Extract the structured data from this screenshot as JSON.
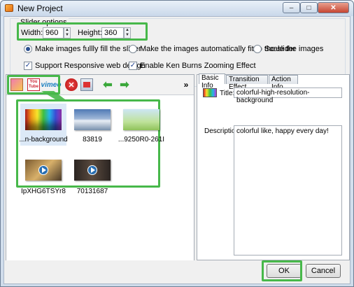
{
  "window": {
    "title": "New Project"
  },
  "slider_options": {
    "group_label": "Slider options",
    "width_label": "Width:",
    "width_value": "960",
    "height_label": "Height:",
    "height_value": "360",
    "fill_modes": [
      {
        "label": "Make images fullly fill the slider",
        "selected": true
      },
      {
        "label": "Make the images automatically fit to the slider",
        "selected": false
      },
      {
        "label": "Scale the images",
        "selected": false
      }
    ],
    "responsive": {
      "label": "Support Responsive web design",
      "checked": true
    },
    "ken_burns": {
      "label": "Enable Ken Burns Zooming Effect",
      "checked": true
    }
  },
  "toolbar": {
    "youtube_text": "You Tube",
    "vimeo_text": "vimeo",
    "expand_glyph": "»"
  },
  "thumbnails": [
    {
      "caption": "...n-background",
      "kind": "image",
      "selected": true
    },
    {
      "caption": "83819",
      "kind": "image",
      "selected": false
    },
    {
      "caption": "...9250R0-261I",
      "kind": "image",
      "selected": false
    },
    {
      "caption": "IpXHG6TSYr8",
      "kind": "video",
      "selected": false
    },
    {
      "caption": "70131687",
      "kind": "video",
      "selected": false
    }
  ],
  "tabs": [
    {
      "label": "Basic Info",
      "active": true
    },
    {
      "label": "Transition Effect",
      "active": false
    },
    {
      "label": "Action Info",
      "active": false
    }
  ],
  "basic_info": {
    "title_label": "Title:",
    "title_value": "colorful-high-resolution-background",
    "description_label": "Description:",
    "description_value": "colorful like, happy every day!"
  },
  "buttons": {
    "ok": "OK",
    "cancel": "Cancel"
  },
  "colors": {
    "highlight": "#47b84a",
    "accent": "#2a6fb1"
  }
}
